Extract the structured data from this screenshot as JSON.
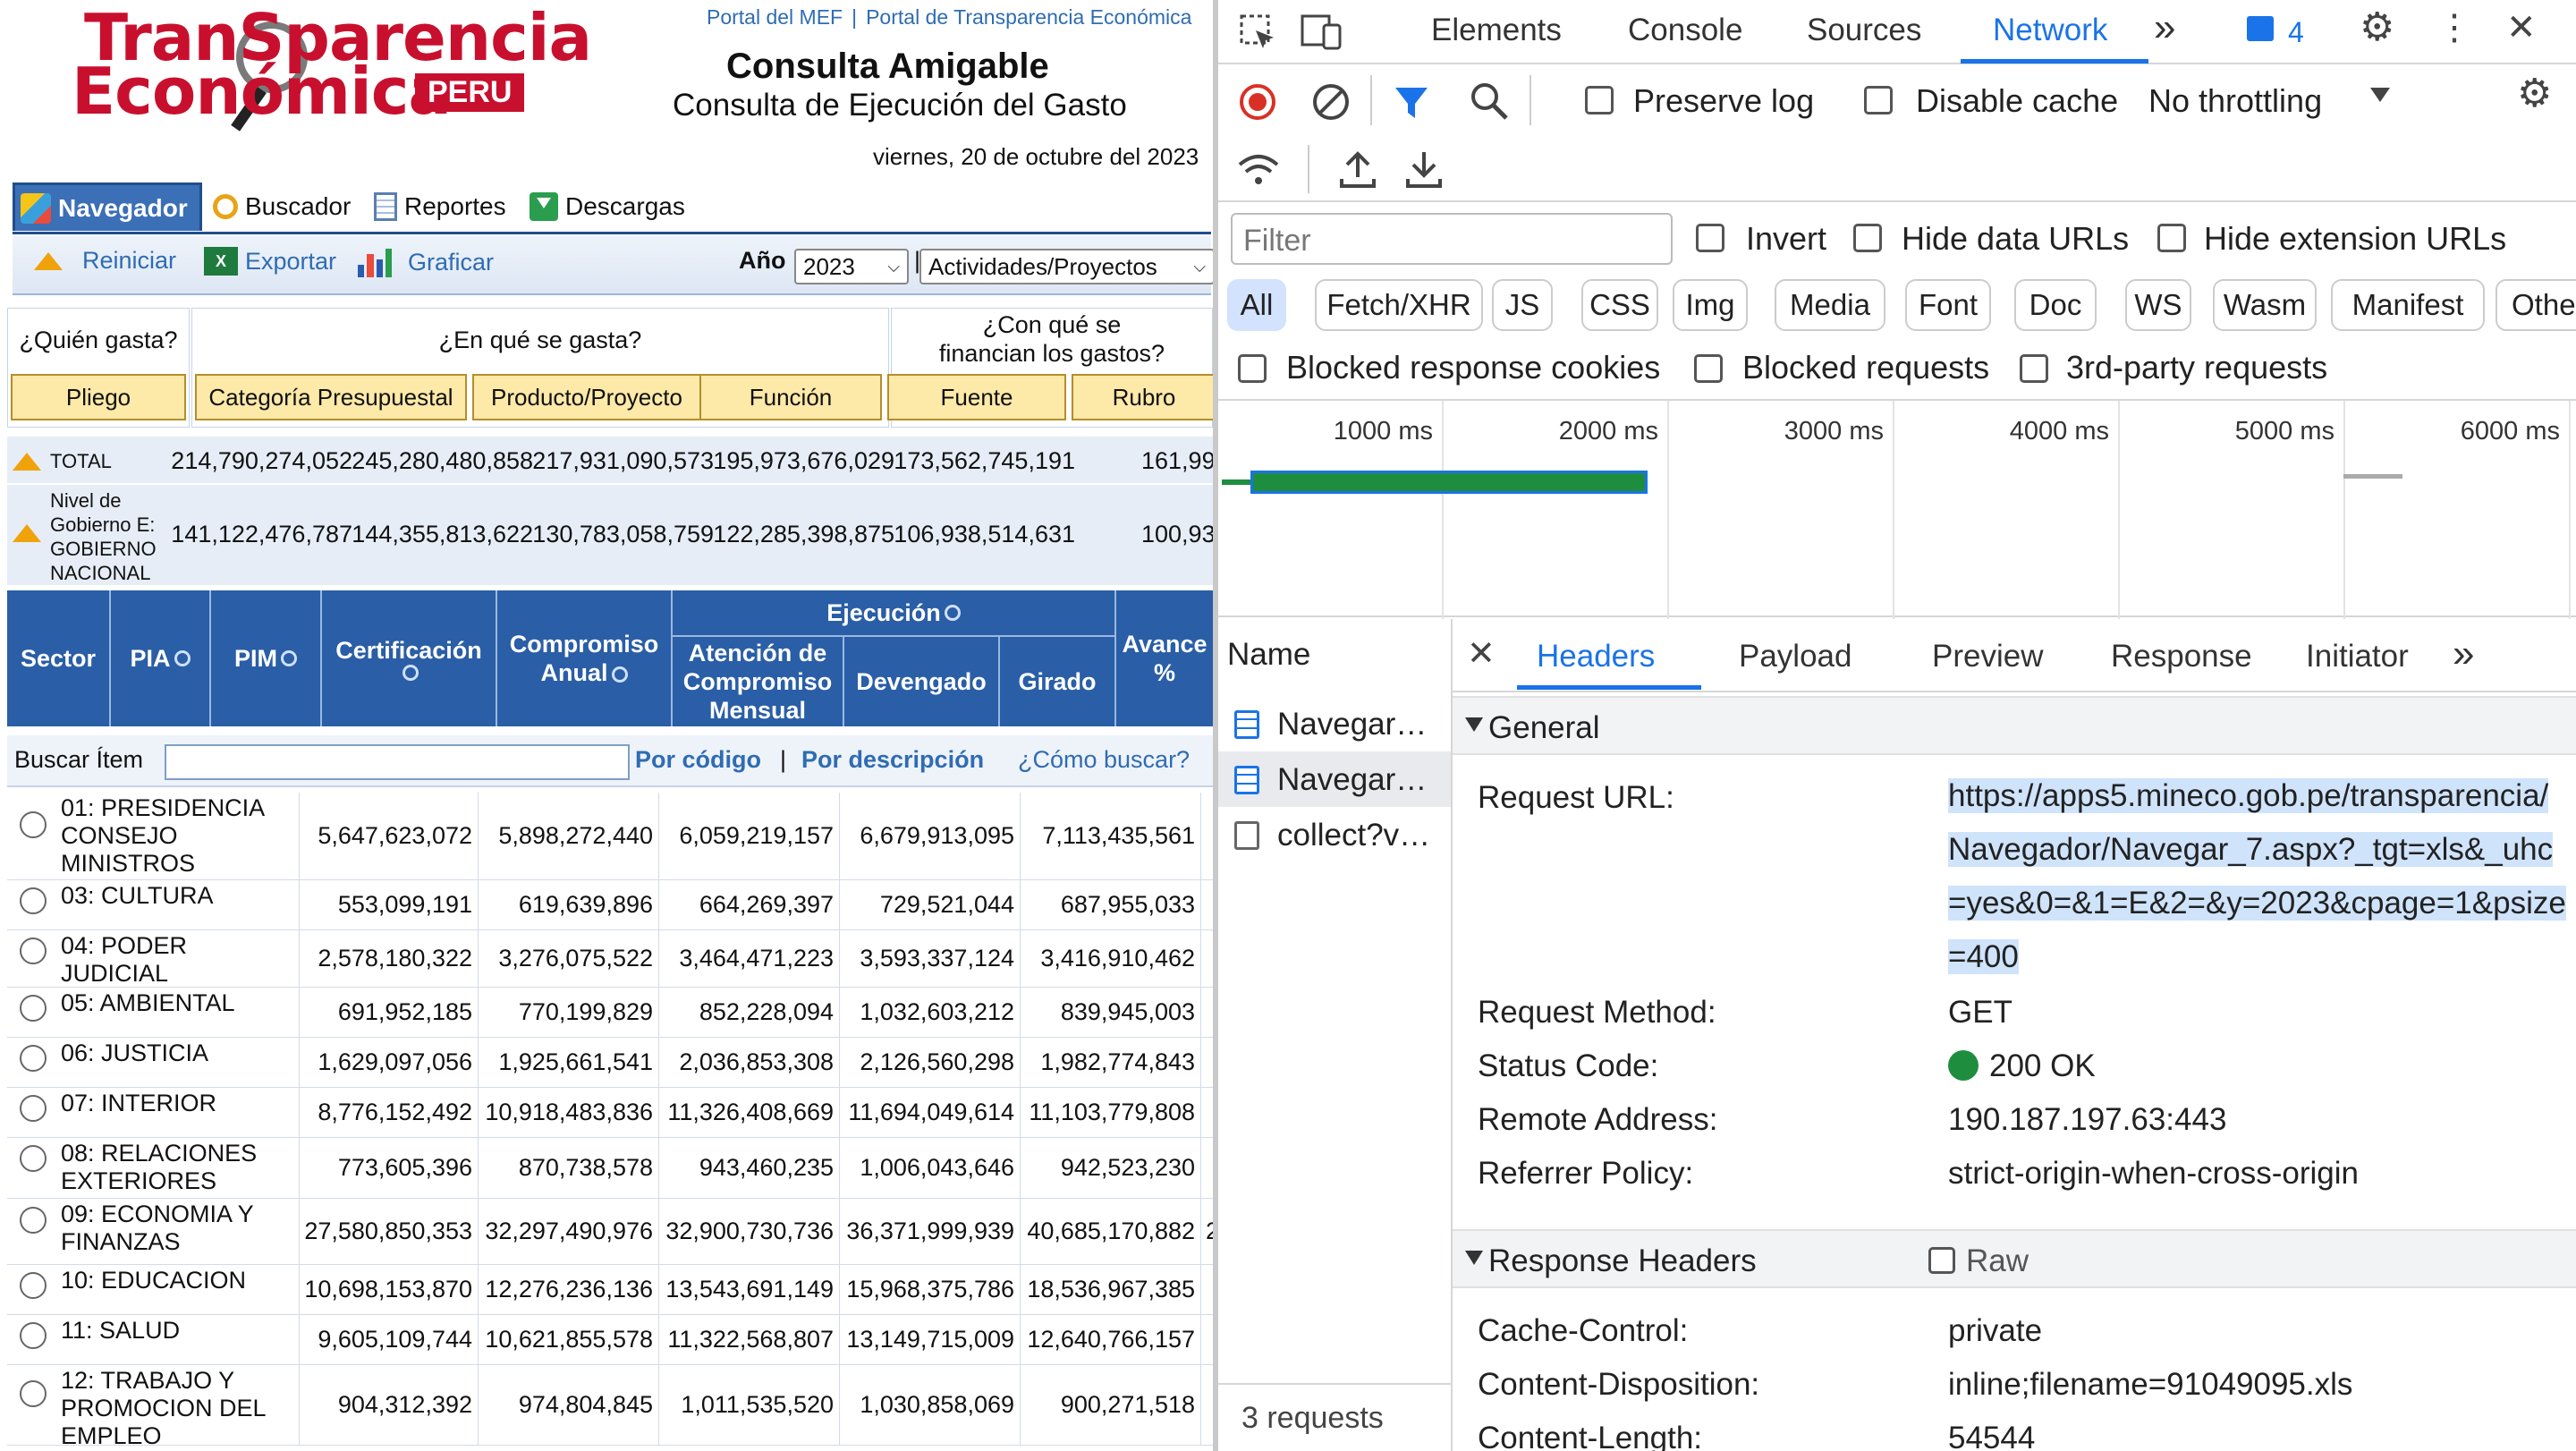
{
  "site": {
    "logo_line1": "TranSparencia",
    "logo_line2": "Económica",
    "logo_peru": "PERU",
    "top_link_1": "Portal del MEF",
    "top_link_sep": "|",
    "top_link_2": "Portal de Transparencia Económica",
    "title": "Consulta Amigable",
    "subtitle": "Consulta de Ejecución del Gasto",
    "date": "viernes, 20 de octubre del 2023"
  },
  "nav_tabs": [
    "Navegador",
    "Buscador",
    "Reportes",
    "Descargas"
  ],
  "actions": {
    "reiniciar": "Reiniciar",
    "exportar": "Exportar",
    "graficar": "Graficar",
    "year_label": "Año",
    "year_value": "2023",
    "pipe": "|",
    "activity_value": "Actividades/Proyectos",
    "xls_glyph": "X"
  },
  "questions": {
    "quien": "¿Quién gasta?",
    "que": "¿En qué se gasta?",
    "con_que_1": "¿Con qué se",
    "con_que_2": "financian los gastos?",
    "buttons": [
      "Pliego",
      "Categoría Presupuestal",
      "Producto/Proyecto",
      "Función",
      "Fuente",
      "Rubro"
    ]
  },
  "totals": [
    {
      "label": "TOTAL",
      "values": [
        "214,790,274,052",
        "245,280,480,858",
        "217,931,090,573",
        "195,973,676,029",
        "173,562,745,191",
        "161,99"
      ]
    },
    {
      "label_lines": [
        "Nivel de",
        "Gobierno E:",
        "GOBIERNO",
        "NACIONAL"
      ],
      "values": [
        "141,122,476,787",
        "144,355,813,622",
        "130,783,058,759",
        "122,285,398,875",
        "106,938,514,631",
        "100,93"
      ]
    }
  ],
  "table_header": {
    "sector": "Sector",
    "pia": "PIA",
    "pim": "PIM",
    "certificacion": "Certificación",
    "compromiso_1": "Compromiso",
    "compromiso_2": "Anual",
    "ejecucion": "Ejecución",
    "atencion_1": "Atención de",
    "atencion_2": "Compromiso",
    "atencion_3": "Mensual",
    "devengado": "Devengado",
    "girado": "Girado",
    "avance_1": "Avance",
    "avance_2": "%"
  },
  "search": {
    "label": "Buscar Ítem",
    "value": "",
    "por_codigo": "Por código",
    "sep": "|",
    "por_descripcion": "Por descripción",
    "como_buscar": "¿Cómo buscar?"
  },
  "rows": [
    {
      "name_lines": [
        "01: PRESIDENCIA",
        "CONSEJO",
        "MINISTROS"
      ],
      "values": [
        "7,113,435,561",
        "6,679,913,095",
        "6,059,219,157",
        "5,898,272,440",
        "5,647,623,072"
      ]
    },
    {
      "name_lines": [
        "03: CULTURA"
      ],
      "values": [
        "687,955,033",
        "729,521,044",
        "664,269,397",
        "619,639,896",
        "553,099,191"
      ]
    },
    {
      "name_lines": [
        "04: PODER",
        "JUDICIAL"
      ],
      "values": [
        "3,416,910,462",
        "3,593,337,124",
        "3,464,471,223",
        "3,276,075,522",
        "2,578,180,322"
      ]
    },
    {
      "name_lines": [
        "05: AMBIENTAL"
      ],
      "values": [
        "839,945,003",
        "1,032,603,212",
        "852,228,094",
        "770,199,829",
        "691,952,185"
      ]
    },
    {
      "name_lines": [
        "06: JUSTICIA"
      ],
      "values": [
        "1,982,774,843",
        "2,126,560,298",
        "2,036,853,308",
        "1,925,661,541",
        "1,629,097,056"
      ]
    },
    {
      "name_lines": [
        "07: INTERIOR"
      ],
      "values": [
        "11,103,779,808",
        "11,694,049,614",
        "11,326,408,669",
        "10,918,483,836",
        "8,776,152,492"
      ]
    },
    {
      "name_lines": [
        "08: RELACIONES",
        "EXTERIORES"
      ],
      "values": [
        "942,523,230",
        "1,006,043,646",
        "943,460,235",
        "870,738,578",
        "773,605,396"
      ]
    },
    {
      "name_lines": [
        "09: ECONOMIA Y",
        "FINANZAS"
      ],
      "values": [
        "40,685,170,882",
        "36,371,999,939",
        "32,900,730,736",
        "32,297,490,976",
        "27,580,850,353"
      ],
      "trail": "2"
    },
    {
      "name_lines": [
        "10: EDUCACION"
      ],
      "values": [
        "18,536,967,385",
        "15,968,375,786",
        "13,543,691,149",
        "12,276,236,136",
        "10,698,153,870"
      ]
    },
    {
      "name_lines": [
        "11: SALUD"
      ],
      "values": [
        "12,640,766,157",
        "13,149,715,009",
        "11,322,568,807",
        "10,621,855,578",
        "9,605,109,744"
      ]
    },
    {
      "name_lines": [
        "12: TRABAJO Y",
        "PROMOCION DEL",
        "EMPLEO"
      ],
      "values": [
        "900,271,518",
        "1,030,858,069",
        "1,011,535,520",
        "974,804,845",
        "904,312,392"
      ]
    }
  ],
  "devtools": {
    "tabs": [
      "Elements",
      "Console",
      "Sources",
      "Network"
    ],
    "active_tab": "Network",
    "more": "»",
    "message_count": "4",
    "preserve_log": "Preserve log",
    "disable_cache": "Disable cache",
    "throttling": "No throttling",
    "filter_placeholder": "Filter",
    "invert": "Invert",
    "hide_data_urls": "Hide data URLs",
    "hide_extension_urls": "Hide extension URLs",
    "type_filters": [
      "All",
      "Fetch/XHR",
      "JS",
      "CSS",
      "Img",
      "Media",
      "Font",
      "Doc",
      "WS",
      "Wasm",
      "Manifest",
      "Other"
    ],
    "blocked_cookies": "Blocked response cookies",
    "blocked_requests": "Blocked requests",
    "third_party": "3rd-party requests",
    "timeline_labels": [
      "1000 ms",
      "2000 ms",
      "3000 ms",
      "4000 ms",
      "5000 ms",
      "6000 ms"
    ],
    "name_header": "Name",
    "requests": [
      "Navegar…",
      "Navegar…",
      "collect?v…"
    ],
    "requests_count": "3 requests",
    "detail_tabs": [
      "Headers",
      "Payload",
      "Preview",
      "Response",
      "Initiator"
    ],
    "general_title": "General",
    "request_url_label": "Request URL:",
    "request_url_lines": [
      "https://apps5.mineco.gob.pe/transparencia/",
      "Navegador/Navegar_7.aspx?_tgt=xls&_uhc",
      "=yes&0=&1=E&2=&y=2023&cpage=1&psize",
      "=400"
    ],
    "request_method_label": "Request Method:",
    "request_method": "GET",
    "status_code_label": "Status Code:",
    "status_code": "200 OK",
    "remote_address_label": "Remote Address:",
    "remote_address": "190.187.197.63:443",
    "referrer_policy_label": "Referrer Policy:",
    "referrer_policy": "strict-origin-when-cross-origin",
    "response_headers_title": "Response Headers",
    "raw_label": "Raw",
    "cache_control_label": "Cache-Control:",
    "cache_control": "private",
    "content_disposition_label": "Content-Disposition:",
    "content_disposition": "inline;filename=91049095.xls",
    "content_length_label": "Content-Length:",
    "content_length": "54544"
  }
}
